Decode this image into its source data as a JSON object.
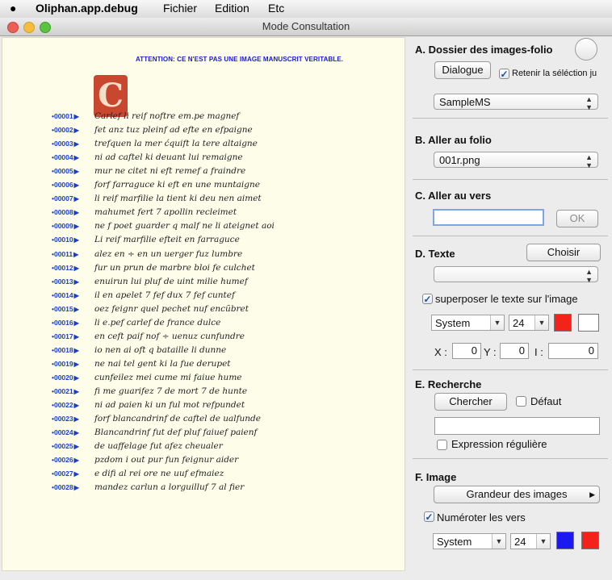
{
  "menubar": {
    "apple": "",
    "app_name": "Oliphan.app.debug",
    "items": [
      "Fichier",
      "Edition",
      "Etc"
    ]
  },
  "window": {
    "title": "Mode Consultation"
  },
  "manuscript": {
    "attention": "ATTENTION: CE N'EST PAS UNE IMAGE MANUSCRIT VERITABLE.",
    "verses": [
      {
        "num": "00001",
        "text": "Carlef li reif noftre em.pe magnef"
      },
      {
        "num": "00002",
        "text": "fet anz tuz pleinf ad efte en efpaigne"
      },
      {
        "num": "00003",
        "text": "trefquen la mer ćquift la tere altaigne"
      },
      {
        "num": "00004",
        "text": "ni ad caftel ki deuant lui remaigne"
      },
      {
        "num": "00005",
        "text": "mur ne citet ni eft remef a fraindre"
      },
      {
        "num": "00006",
        "text": "forf farraguce ki eft en une muntaigne"
      },
      {
        "num": "00007",
        "text": "li reif marfilie la tient ki deu nen aimet"
      },
      {
        "num": "00008",
        "text": "mahumet fert 7 apollin recleimet"
      },
      {
        "num": "00009",
        "text": "ne f poet guarder q malf ne li ateignet aoi"
      },
      {
        "num": "00010",
        "text": "Li reif marfilie efteit en farraguce"
      },
      {
        "num": "00011",
        "text": "alez en ÷ en un uerger fuz lumbre"
      },
      {
        "num": "00012",
        "text": "fur un prun de marbre bloi fe culchet"
      },
      {
        "num": "00013",
        "text": "enuirun lui pluf de uint milie humef"
      },
      {
        "num": "00014",
        "text": "il en apelet 7 fef dux 7 fef cuntef"
      },
      {
        "num": "00015",
        "text": "oez feignr quel pechet nuf encũbret"
      },
      {
        "num": "00016",
        "text": "li e.pef carlef de france dulce"
      },
      {
        "num": "00017",
        "text": "en ceft paif nof ÷ uenuz cunfundre"
      },
      {
        "num": "00018",
        "text": "io nen ai oft q bataille li dunne"
      },
      {
        "num": "00019",
        "text": "ne nai tel gent ki la fue derupet"
      },
      {
        "num": "00020",
        "text": "cunfeilez mei cume mi faiue hume"
      },
      {
        "num": "00021",
        "text": "fi me guarifez 7 de mort 7 de hunte"
      },
      {
        "num": "00022",
        "text": "ni ad paien ki un ful mot refpundet"
      },
      {
        "num": "00023",
        "text": "forf blancandrinf de caftel de ualfunde"
      },
      {
        "num": "00024",
        "text": "Blancandrinf fut def pluf faiuef paienf"
      },
      {
        "num": "00025",
        "text": "de uaffelage fut afez cheualer"
      },
      {
        "num": "00026",
        "text": "pzdom i out pur fun feignur aider"
      },
      {
        "num": "00027",
        "text": "e difi al rei ore ne uuf efmaiez"
      },
      {
        "num": "00028",
        "text": "mandez carlun a lorguilluf 7 al fier"
      }
    ]
  },
  "panel": {
    "sectionA": {
      "title": "A. Dossier des images-folio",
      "dialog_button": "Dialogue",
      "retain_label": "Retenir la séléction ju",
      "retain_checked": true,
      "folder_popup": "SampleMS"
    },
    "sectionB": {
      "title": "B. Aller au folio",
      "folio_popup": "001r.png"
    },
    "sectionC": {
      "title": "C. Aller au vers",
      "verse_input": "",
      "ok_button": "OK"
    },
    "sectionD": {
      "title": "D. Texte",
      "choose_button": "Choisir",
      "text_popup": "",
      "overlay_label": "superposer le texte sur l'image",
      "overlay_checked": true,
      "font": "System",
      "size": "24",
      "color1": "#f3231a",
      "color2": "#ffffff",
      "x_label": "X :",
      "x_value": "0",
      "y_label": "Y :",
      "y_value": "0",
      "i_label": "I :",
      "i_value": "0"
    },
    "sectionE": {
      "title": "E. Recherche",
      "search_button": "Chercher",
      "default_label": "Défaut",
      "default_checked": false,
      "search_input": "",
      "regex_label": "Expression régulière",
      "regex_checked": false
    },
    "sectionF": {
      "title": "F. Image",
      "size_button": "Grandeur des images",
      "number_label": "Numéroter les vers",
      "number_checked": true,
      "font": "System",
      "size": "24",
      "color1": "#1a1af0",
      "color2": "#f3231a"
    }
  }
}
